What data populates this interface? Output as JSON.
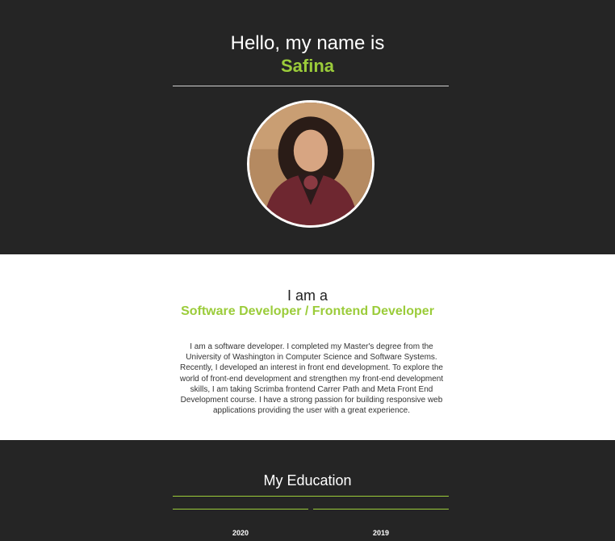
{
  "hero": {
    "greeting": "Hello, my name is",
    "name": "Safina"
  },
  "about": {
    "intro": "I am a",
    "role": "Software Developer / Frontend Developer",
    "bio": "I am a software developer. I completed my Master's degree from the University of Washington in Computer Science and Software Systems. Recently, I developed an interest in front end development. To explore the world of front-end development and strengthen my front-end development skills, I am taking Scrimba frontend Carrer Path and Meta Front End Development course. I have a strong passion for building responsive web applications providing the user with a great experience."
  },
  "education": {
    "title": "My Education",
    "cards": [
      {
        "year": "2020"
      },
      {
        "year": "2019"
      }
    ]
  },
  "colors": {
    "accent": "#9bcc3a",
    "dark": "#252525",
    "light": "#ffffff"
  },
  "icons": {
    "avatar": "profile-photo"
  }
}
